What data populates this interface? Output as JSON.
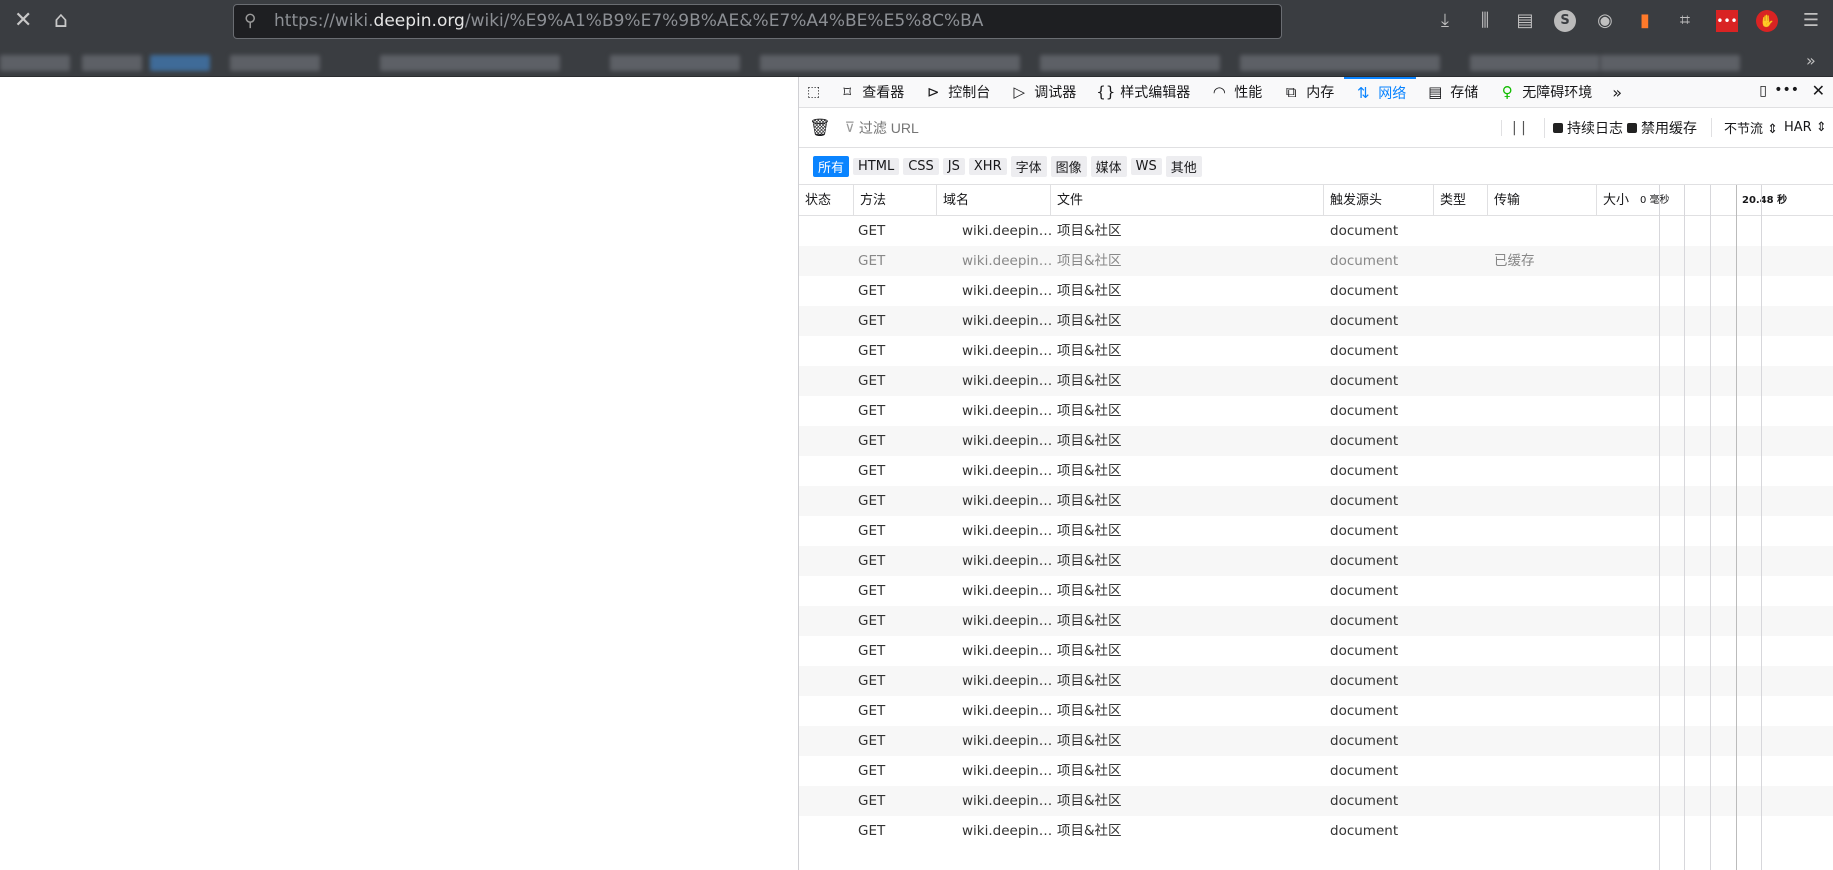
{
  "browser": {
    "url_scheme": "https://wiki.",
    "url_host": "deepin.org",
    "url_path": "/wiki/%E9%A1%B9%E7%9B%AE&%E7%A4%BE%E5%8C%BA"
  },
  "devtools": {
    "tabs": [
      {
        "label": "查看器",
        "icon": "inspector-icon"
      },
      {
        "label": "控制台",
        "icon": "console-icon"
      },
      {
        "label": "调试器",
        "icon": "debugger-icon"
      },
      {
        "label": "样式编辑器",
        "icon": "braces-icon"
      },
      {
        "label": "性能",
        "icon": "gauge-icon"
      },
      {
        "label": "内存",
        "icon": "chip-icon"
      },
      {
        "label": "网络",
        "icon": "arrows-updown-icon"
      },
      {
        "label": "存储",
        "icon": "storage-icon"
      },
      {
        "label": "无障碍环境",
        "icon": "accessibility-icon"
      }
    ],
    "selected_tab": "网络",
    "filter_placeholder": "过滤 URL",
    "persist_log": "持续日志",
    "disable_cache": "禁用缓存",
    "throttle": "不节流",
    "har": "HAR",
    "type_filters": [
      "所有",
      "HTML",
      "CSS",
      "JS",
      "XHR",
      "字体",
      "图像",
      "媒体",
      "WS",
      "其他"
    ],
    "columns": [
      "状态",
      "方法",
      "域名",
      "文件",
      "触发源头",
      "类型",
      "传输",
      "大小"
    ],
    "waterfall_start": "0 毫秒",
    "waterfall_end": "20.48 秒",
    "rows": [
      {
        "method": "GET",
        "domain": "wiki.deepin…",
        "file": "项目&社区",
        "cause": "document",
        "transferred": ""
      },
      {
        "method": "GET",
        "domain": "wiki.deepin…",
        "file": "项目&社区",
        "cause": "document",
        "transferred": "已缓存"
      },
      {
        "method": "GET",
        "domain": "wiki.deepin…",
        "file": "项目&社区",
        "cause": "document",
        "transferred": ""
      },
      {
        "method": "GET",
        "domain": "wiki.deepin…",
        "file": "项目&社区",
        "cause": "document",
        "transferred": ""
      },
      {
        "method": "GET",
        "domain": "wiki.deepin…",
        "file": "项目&社区",
        "cause": "document",
        "transferred": ""
      },
      {
        "method": "GET",
        "domain": "wiki.deepin…",
        "file": "项目&社区",
        "cause": "document",
        "transferred": ""
      },
      {
        "method": "GET",
        "domain": "wiki.deepin…",
        "file": "项目&社区",
        "cause": "document",
        "transferred": ""
      },
      {
        "method": "GET",
        "domain": "wiki.deepin…",
        "file": "项目&社区",
        "cause": "document",
        "transferred": ""
      },
      {
        "method": "GET",
        "domain": "wiki.deepin…",
        "file": "项目&社区",
        "cause": "document",
        "transferred": ""
      },
      {
        "method": "GET",
        "domain": "wiki.deepin…",
        "file": "项目&社区",
        "cause": "document",
        "transferred": ""
      },
      {
        "method": "GET",
        "domain": "wiki.deepin…",
        "file": "项目&社区",
        "cause": "document",
        "transferred": ""
      },
      {
        "method": "GET",
        "domain": "wiki.deepin…",
        "file": "项目&社区",
        "cause": "document",
        "transferred": ""
      },
      {
        "method": "GET",
        "domain": "wiki.deepin…",
        "file": "项目&社区",
        "cause": "document",
        "transferred": ""
      },
      {
        "method": "GET",
        "domain": "wiki.deepin…",
        "file": "项目&社区",
        "cause": "document",
        "transferred": ""
      },
      {
        "method": "GET",
        "domain": "wiki.deepin…",
        "file": "项目&社区",
        "cause": "document",
        "transferred": ""
      },
      {
        "method": "GET",
        "domain": "wiki.deepin…",
        "file": "项目&社区",
        "cause": "document",
        "transferred": ""
      },
      {
        "method": "GET",
        "domain": "wiki.deepin…",
        "file": "项目&社区",
        "cause": "document",
        "transferred": ""
      },
      {
        "method": "GET",
        "domain": "wiki.deepin…",
        "file": "项目&社区",
        "cause": "document",
        "transferred": ""
      },
      {
        "method": "GET",
        "domain": "wiki.deepin…",
        "file": "项目&社区",
        "cause": "document",
        "transferred": ""
      },
      {
        "method": "GET",
        "domain": "wiki.deepin…",
        "file": "项目&社区",
        "cause": "document",
        "transferred": ""
      },
      {
        "method": "GET",
        "domain": "wiki.deepin…",
        "file": "项目&社区",
        "cause": "document",
        "transferred": ""
      }
    ]
  }
}
